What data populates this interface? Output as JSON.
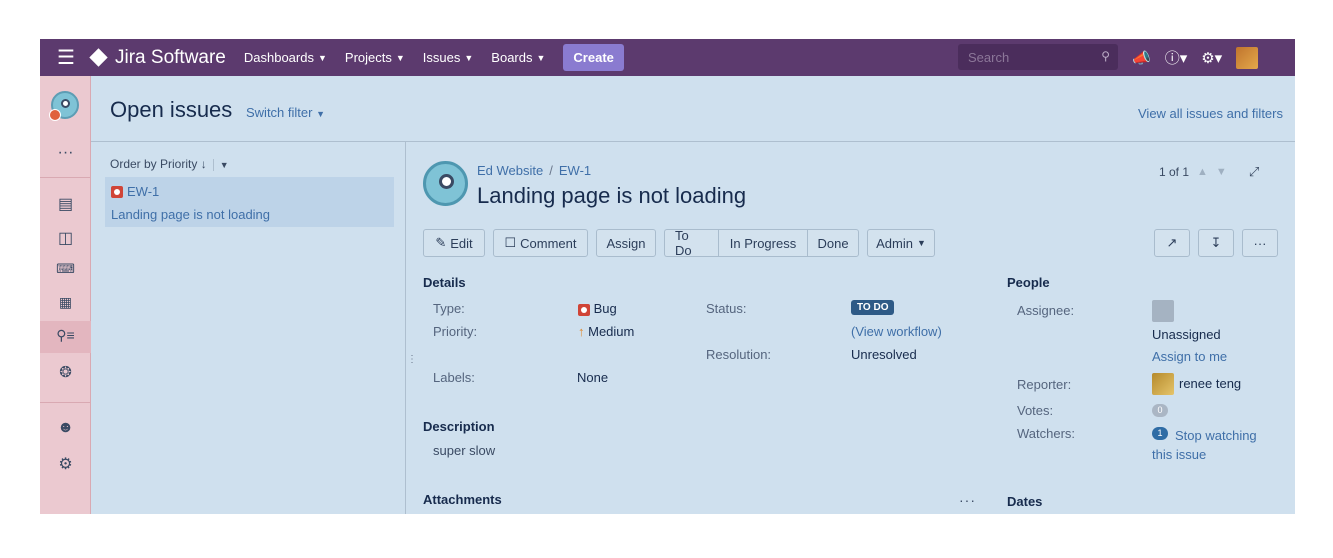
{
  "topbar": {
    "logo_text": "Jira Software",
    "nav": [
      "Dashboards",
      "Projects",
      "Issues",
      "Boards"
    ],
    "create_label": "Create",
    "search_placeholder": "Search"
  },
  "header": {
    "title": "Open issues",
    "switch_filter": "Switch filter",
    "view_all": "View all issues and filters"
  },
  "list": {
    "order_label": "Order by Priority",
    "items": [
      {
        "key": "EW-1",
        "summary": "Landing page is not loading"
      }
    ]
  },
  "issue": {
    "project": "Ed Website",
    "key": "EW-1",
    "title": "Landing page is not loading",
    "pager": "1 of 1",
    "buttons": {
      "edit": "Edit",
      "comment": "Comment",
      "assign": "Assign",
      "todo": "To Do",
      "inprogress": "In Progress",
      "done": "Done",
      "admin": "Admin"
    },
    "details": {
      "heading": "Details",
      "type_label": "Type:",
      "type_value": "Bug",
      "priority_label": "Priority:",
      "priority_value": "Medium",
      "status_label": "Status:",
      "status_value": "TO DO",
      "view_workflow": "(View workflow)",
      "resolution_label": "Resolution:",
      "resolution_value": "Unresolved",
      "labels_label": "Labels:",
      "labels_value": "None"
    },
    "description": {
      "heading": "Description",
      "text": "super slow"
    },
    "attachments_heading": "Attachments",
    "people": {
      "heading": "People",
      "assignee_label": "Assignee:",
      "assignee_value": "Unassigned",
      "assign_to_me": "Assign to me",
      "reporter_label": "Reporter:",
      "reporter_value": "renee teng",
      "votes_label": "Votes:",
      "votes_count": "0",
      "watchers_label": "Watchers:",
      "watchers_count": "1",
      "stop_watching": "Stop watching this issue"
    },
    "dates_heading": "Dates"
  },
  "colors": {
    "topbar": "#5c3a6e",
    "sidebar": "#ebc9d0",
    "content": "#cfe0ee",
    "link": "#3f6fa8",
    "create": "#8a7bd0"
  }
}
